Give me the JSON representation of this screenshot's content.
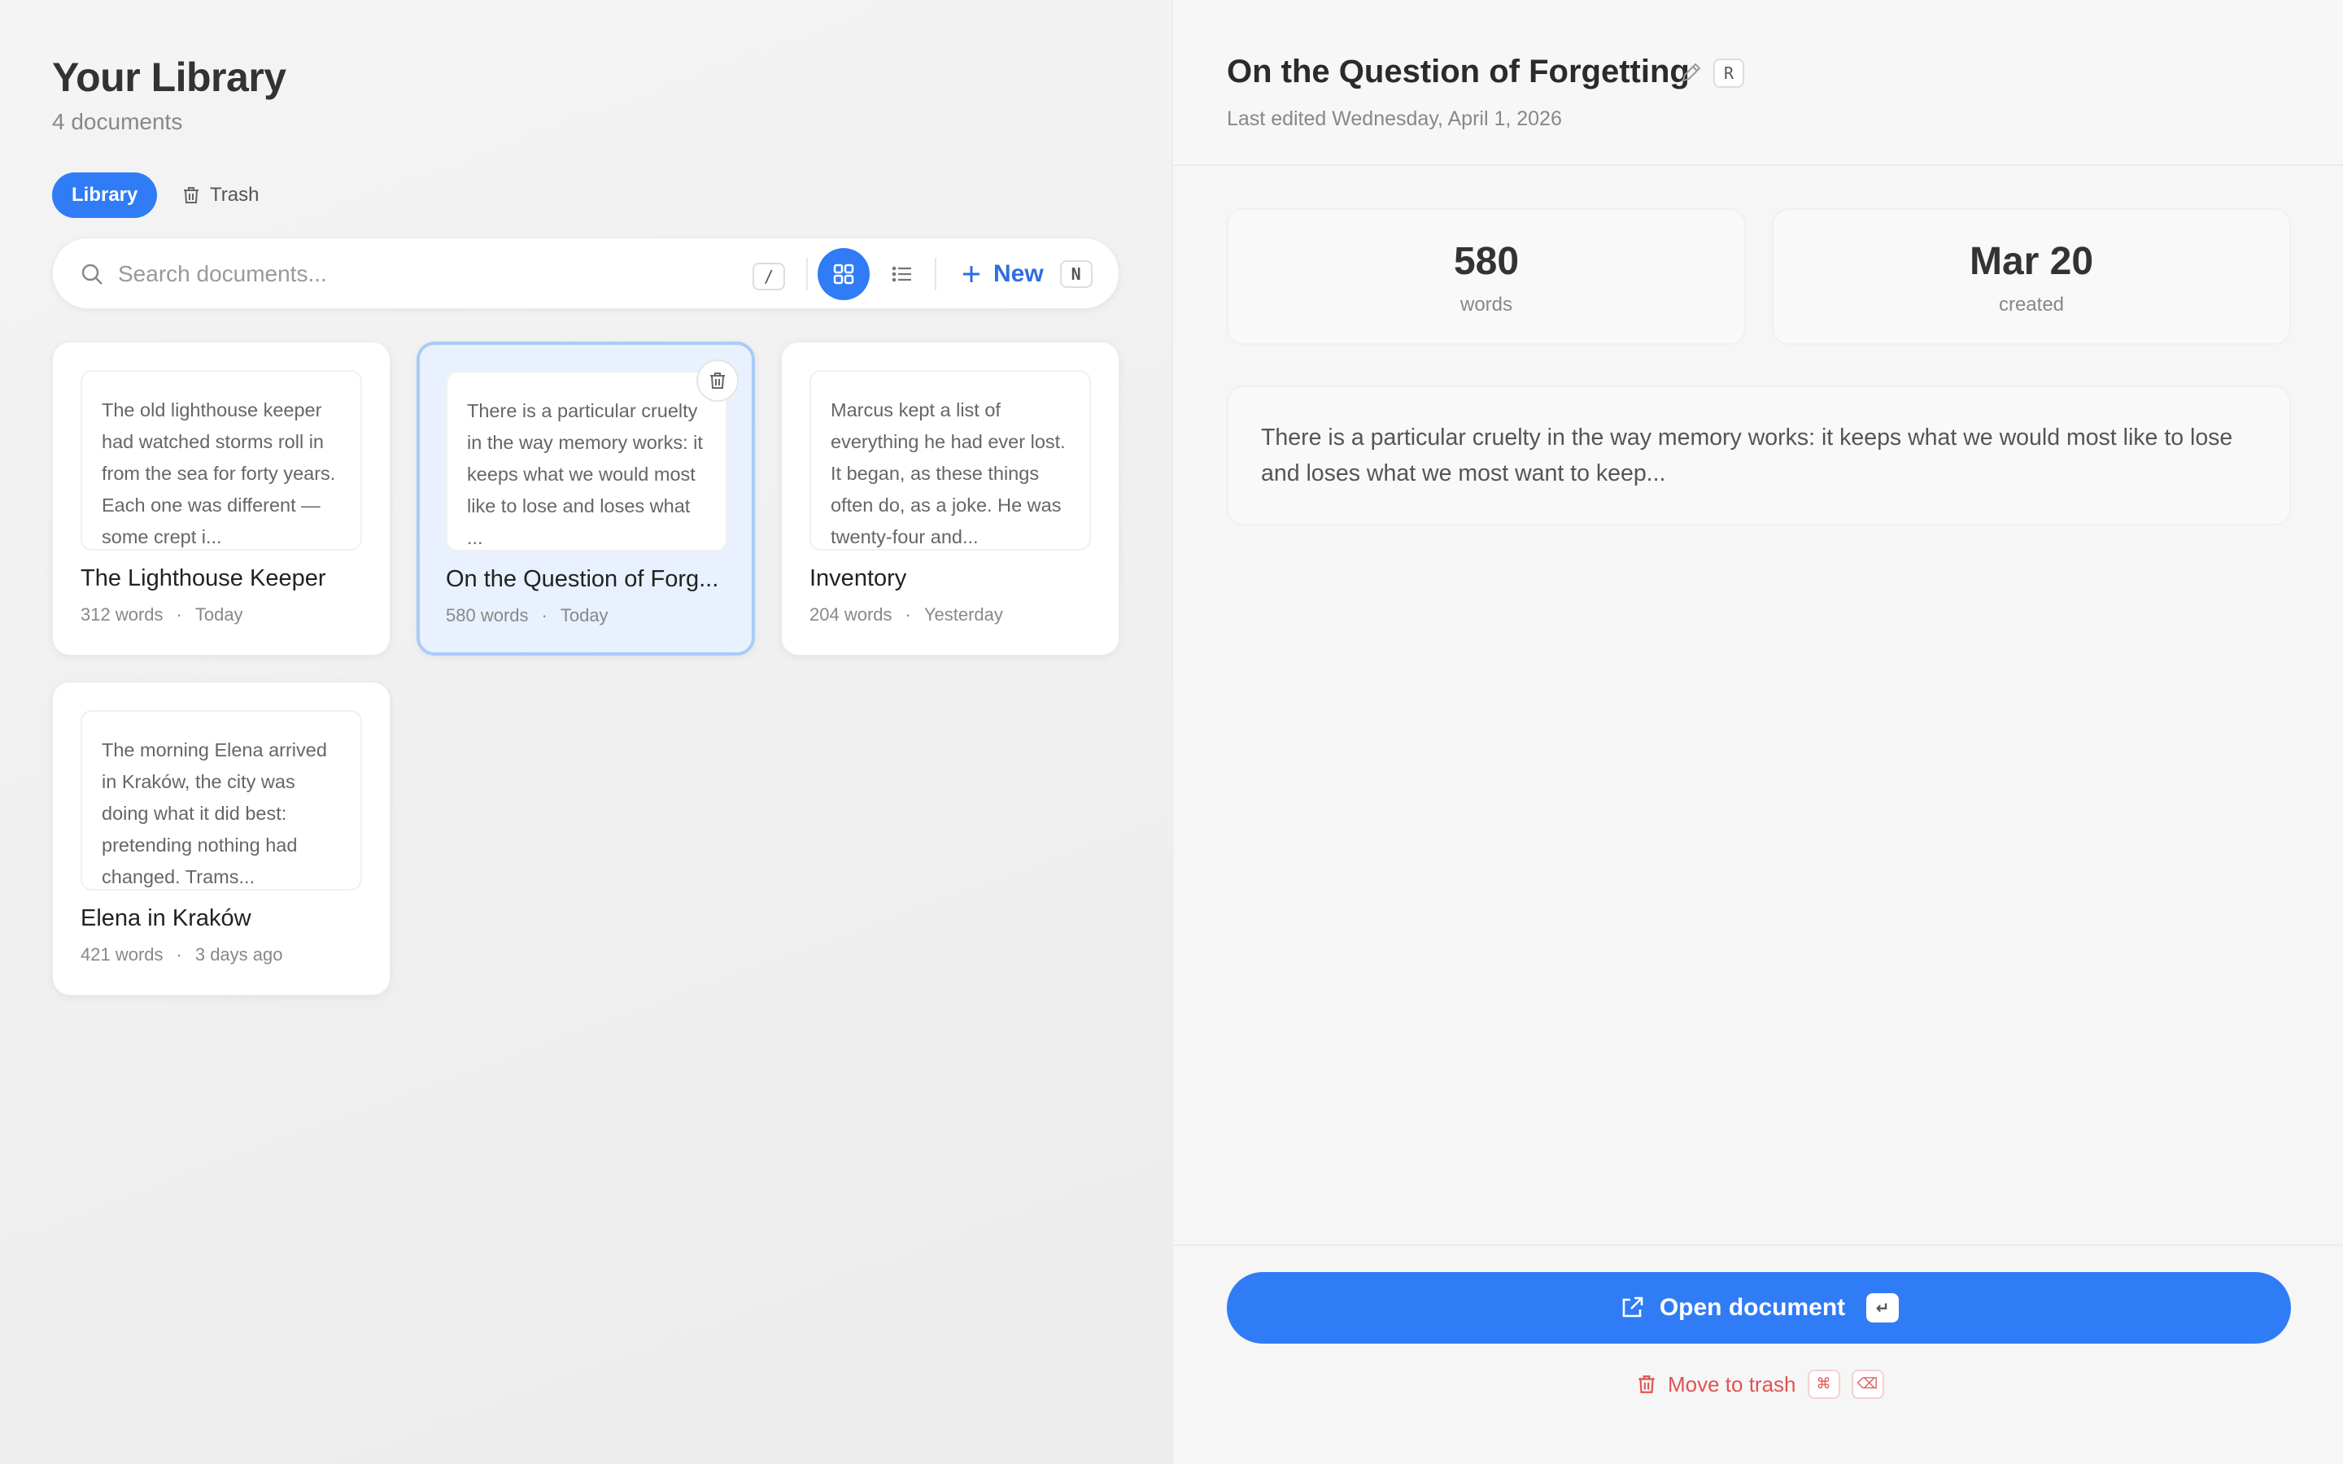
{
  "library": {
    "title": "Your Library",
    "count_label": "4 documents",
    "tabs": {
      "library": "Library",
      "trash": "Trash"
    },
    "search": {
      "placeholder": "Search documents...",
      "shortcut": "/"
    },
    "new_button": {
      "label": "New",
      "shortcut": "N"
    },
    "view_mode": "grid",
    "documents": [
      {
        "title": "The Lighthouse Keeper",
        "preview": "The old lighthouse keeper had watched storms roll in from the sea for forty years. Each one was different — some crept i...",
        "words": "312 words",
        "dot": "·",
        "date": "Today"
      },
      {
        "title": "On the Question of Forg...",
        "preview": "There is a particular cruelty in the way memory works: it keeps what we would most like to lose and loses what ...",
        "words": "580 words",
        "dot": "·",
        "date": "Today"
      },
      {
        "title": "Inventory",
        "preview": "Marcus kept a list of everything he had ever lost. It began, as these things often do, as a joke. He was twenty-four and...",
        "words": "204 words",
        "dot": "·",
        "date": "Yesterday"
      },
      {
        "title": "Elena in Kraków",
        "preview": "The morning Elena arrived in Kraków, the city was doing what it did best: pretending nothing had changed. Trams...",
        "words": "421 words",
        "dot": "·",
        "date": "3 days ago"
      }
    ]
  },
  "detail": {
    "title": "On the Question of Forgetting",
    "rename_shortcut": "R",
    "last_edited": "Last edited Wednesday, April 1, 2026",
    "stats": [
      {
        "value": "580",
        "label": "words"
      },
      {
        "value": "Mar 20",
        "label": "created"
      }
    ],
    "excerpt": "There is a particular cruelty in the way memory works: it keeps what we would most like to lose and loses what we most want to keep...",
    "open_button": {
      "label": "Open document",
      "shortcut": "↵"
    },
    "trash_link": {
      "label": "Move to trash",
      "shortcuts": [
        "⌘",
        "⌫"
      ]
    }
  },
  "colors": {
    "accent": "#2f7cf6",
    "danger": "#e05454",
    "selected_card_bg": "#e8f1fd"
  }
}
